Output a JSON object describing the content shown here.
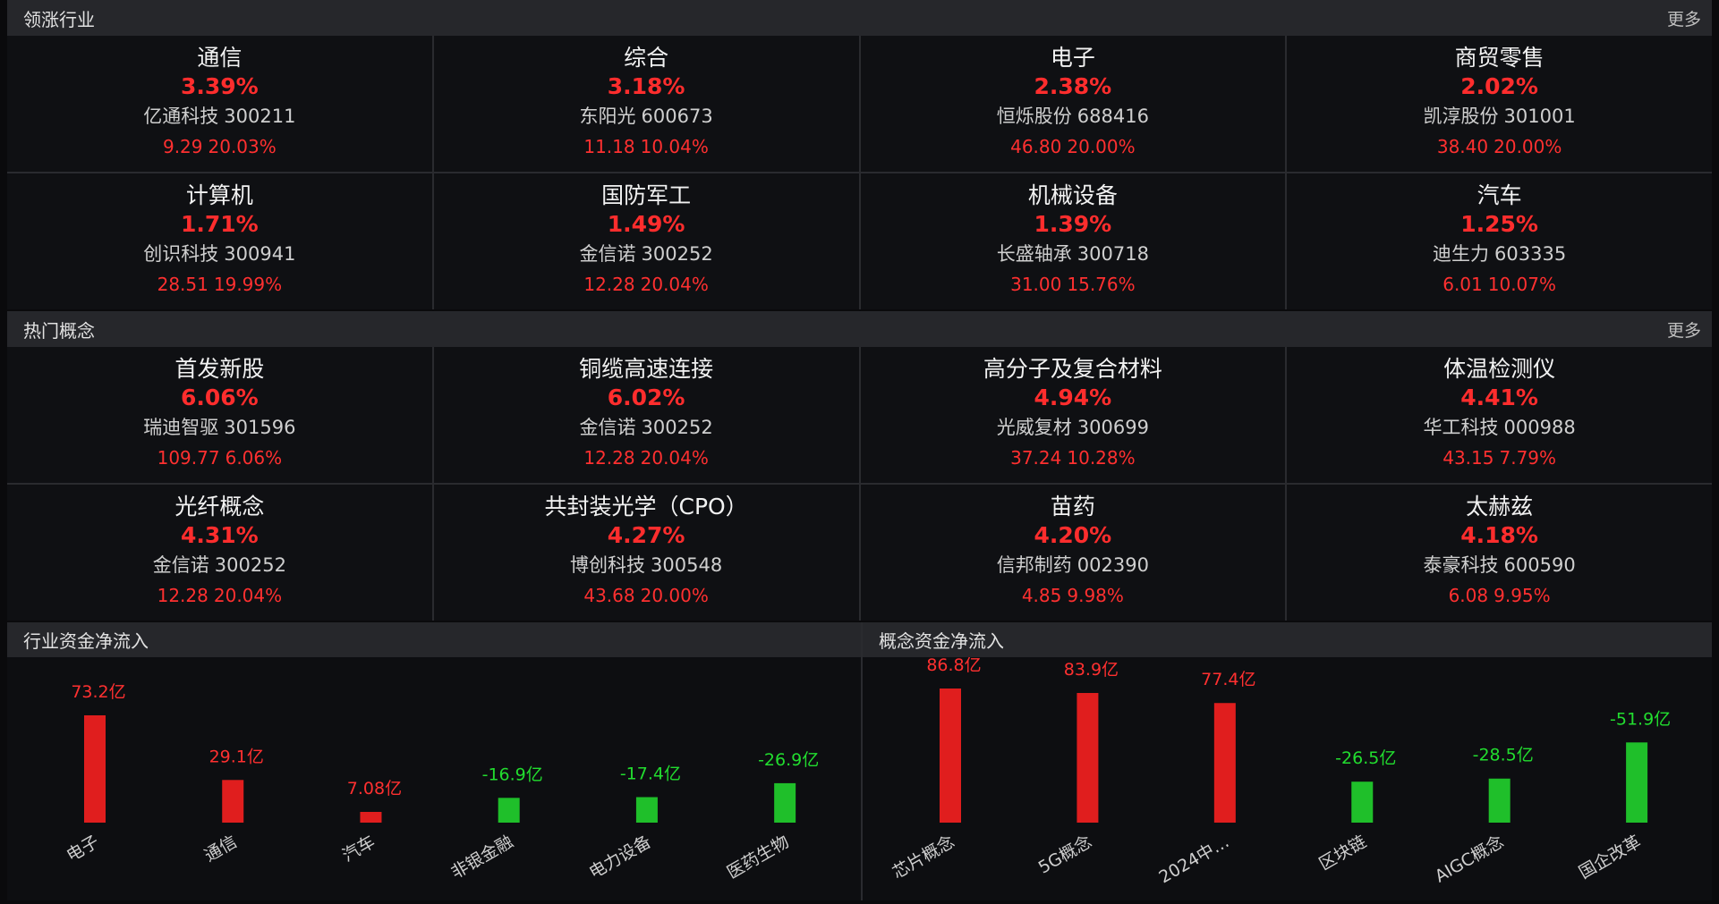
{
  "colors": {
    "up": "#e01e1e",
    "down": "#1fbf2a",
    "up_text": "#ff3030",
    "down_text": "#22dd2f"
  },
  "leading": {
    "title": "领涨行业",
    "more": "更多",
    "items": [
      {
        "name": "通信",
        "pct": "3.39%",
        "stock": "亿通科技",
        "code": "300211",
        "price": "9.29",
        "chg": "20.03%"
      },
      {
        "name": "综合",
        "pct": "3.18%",
        "stock": "东阳光",
        "code": "600673",
        "price": "11.18",
        "chg": "10.04%"
      },
      {
        "name": "电子",
        "pct": "2.38%",
        "stock": "恒烁股份",
        "code": "688416",
        "price": "46.80",
        "chg": "20.00%"
      },
      {
        "name": "商贸零售",
        "pct": "2.02%",
        "stock": "凯淳股份",
        "code": "301001",
        "price": "38.40",
        "chg": "20.00%"
      },
      {
        "name": "计算机",
        "pct": "1.71%",
        "stock": "创识科技",
        "code": "300941",
        "price": "28.51",
        "chg": "19.99%"
      },
      {
        "name": "国防军工",
        "pct": "1.49%",
        "stock": "金信诺",
        "code": "300252",
        "price": "12.28",
        "chg": "20.04%"
      },
      {
        "name": "机械设备",
        "pct": "1.39%",
        "stock": "长盛轴承",
        "code": "300718",
        "price": "31.00",
        "chg": "15.76%"
      },
      {
        "name": "汽车",
        "pct": "1.25%",
        "stock": "迪生力",
        "code": "603335",
        "price": "6.01",
        "chg": "10.07%"
      }
    ]
  },
  "concepts": {
    "title": "热门概念",
    "more": "更多",
    "items": [
      {
        "name": "首发新股",
        "pct": "6.06%",
        "stock": "瑞迪智驱",
        "code": "301596",
        "price": "109.77",
        "chg": "6.06%"
      },
      {
        "name": "铜缆高速连接",
        "pct": "6.02%",
        "stock": "金信诺",
        "code": "300252",
        "price": "12.28",
        "chg": "20.04%"
      },
      {
        "name": "高分子及复合材料",
        "pct": "4.94%",
        "stock": "光威复材",
        "code": "300699",
        "price": "37.24",
        "chg": "10.28%"
      },
      {
        "name": "体温检测仪",
        "pct": "4.41%",
        "stock": "华工科技",
        "code": "000988",
        "price": "43.15",
        "chg": "7.79%"
      },
      {
        "name": "光纤概念",
        "pct": "4.31%",
        "stock": "金信诺",
        "code": "300252",
        "price": "12.28",
        "chg": "20.04%"
      },
      {
        "name": "共封装光学（CPO）",
        "pct": "4.27%",
        "stock": "博创科技",
        "code": "300548",
        "price": "43.68",
        "chg": "20.00%"
      },
      {
        "name": "苗药",
        "pct": "4.20%",
        "stock": "信邦制药",
        "code": "002390",
        "price": "4.85",
        "chg": "9.98%"
      },
      {
        "name": "太赫兹",
        "pct": "4.18%",
        "stock": "泰豪科技",
        "code": "600590",
        "price": "6.08",
        "chg": "9.95%"
      }
    ]
  },
  "flows": [
    {
      "title": "行业资金净流入",
      "chart_data": {
        "type": "bar",
        "categories": [
          "电子",
          "通信",
          "汽车",
          "非银金融",
          "电力设备",
          "医药生物"
        ],
        "values": [
          73.2,
          29.1,
          7.08,
          -16.9,
          -17.4,
          -26.9
        ],
        "labels": [
          "73.2亿",
          "29.1亿",
          "7.08亿",
          "-16.9亿",
          "-17.4亿",
          "-26.9亿"
        ]
      }
    },
    {
      "title": "概念资金净流入",
      "chart_data": {
        "type": "bar",
        "categories": [
          "芯片概念",
          "5G概念",
          "2024中…",
          "区块链",
          "AIGC概念",
          "国企改革"
        ],
        "values": [
          86.8,
          83.9,
          77.4,
          -26.5,
          -28.5,
          -51.9
        ],
        "labels": [
          "86.8亿",
          "83.9亿",
          "77.4亿",
          "-26.5亿",
          "-28.5亿",
          "-51.9亿"
        ]
      }
    }
  ]
}
